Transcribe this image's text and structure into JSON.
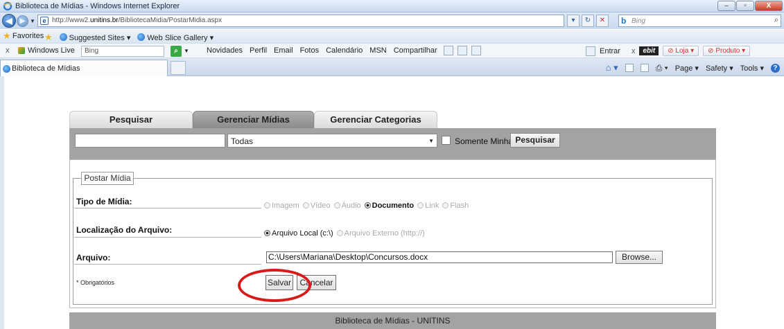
{
  "window": {
    "title": "Biblioteca de Mídias - Windows Internet Explorer",
    "buttons": {
      "minimize": "–",
      "maximize": "▫",
      "close": "X"
    }
  },
  "address_bar": {
    "url_prefix": "http://www2.",
    "url_bold": "unitins.br",
    "url_suffix": "/BibliotecaMidia/PostarMidia.aspx",
    "search_placeholder": "Bing"
  },
  "favorites_bar": {
    "label": "Favorites",
    "items": [
      "Suggested Sites ▾",
      "Web Slice Gallery ▾"
    ]
  },
  "live_toolbar": {
    "brand": "Windows Live",
    "search_value": "Bing",
    "links": [
      "Novidades",
      "Perfil",
      "Email",
      "Fotos",
      "Calendário",
      "MSN",
      "Compartilhar"
    ],
    "enter_label": "Entrar",
    "ebit_label": "ebit",
    "loja_label": "Loja",
    "produto_label": "Produto"
  },
  "browser_tab": {
    "label": "Biblioteca de Mídias"
  },
  "command_bar": {
    "page": "Page ▾",
    "safety": "Safety ▾",
    "tools": "Tools ▾"
  },
  "app_tabs": [
    {
      "label": "Pesquisar",
      "active": false
    },
    {
      "label": "Gerenciar Mídias",
      "active": true
    },
    {
      "label": "Gerenciar Categorias",
      "active": false
    }
  ],
  "search_bar": {
    "input_value": "",
    "select_value": "Todas",
    "checkbox_label": "Somente Minhas",
    "button_label": "Pesquisar"
  },
  "form": {
    "legend": "Postar Mídia",
    "tipo_label": "Tipo de Mídia:",
    "tipo_options": [
      {
        "label": "Imagem",
        "selected": false
      },
      {
        "label": "Vídeo",
        "selected": false
      },
      {
        "label": "Áudio",
        "selected": false
      },
      {
        "label": "Documento",
        "selected": true
      },
      {
        "label": "Link",
        "selected": false
      },
      {
        "label": "Flash",
        "selected": false
      }
    ],
    "local_label": "Localização do Arquivo:",
    "local_options": [
      {
        "label": "Arquivo Local (c:\\)",
        "selected": true
      },
      {
        "label": "Arquivo Externo (http://)",
        "selected": false
      }
    ],
    "arquivo_label": "Arquivo:",
    "arquivo_value": "C:\\Users\\Mariana\\Desktop\\Concursos.docx",
    "browse_label": "Browse...",
    "required_note": "* Obrigatórios",
    "save_label": "Salvar",
    "cancel_label": "Cancelar"
  },
  "footer": {
    "text": "Biblioteca de Mídias - UNITINS"
  },
  "colors": {
    "annotation_circle": "#d81a1a",
    "bar_gray": "#a3a3a3"
  }
}
